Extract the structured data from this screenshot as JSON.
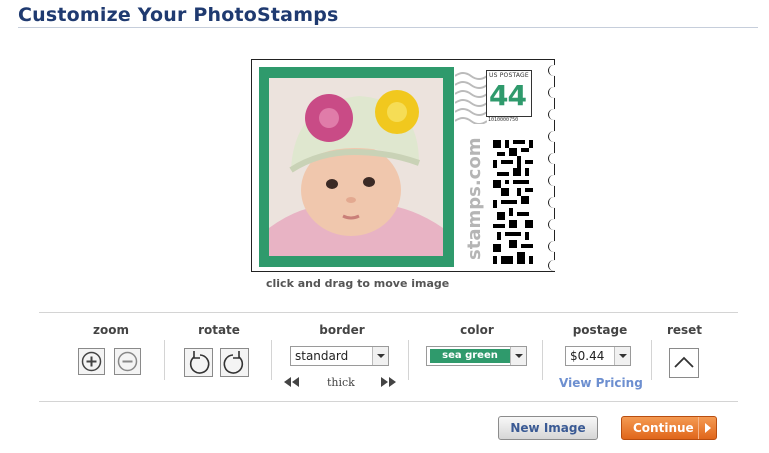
{
  "header": {
    "title": "Customize Your PhotoStamps"
  },
  "stamp": {
    "usps_label": "US POSTAGE",
    "denomination": "44",
    "code_number": "1010000750",
    "brand": "stamps.com",
    "border_color": "#2f9a6c"
  },
  "caption": "click and drag to move image",
  "controls": {
    "zoom": {
      "label": "zoom",
      "in_icon": "zoom-in-icon",
      "out_icon": "zoom-out-icon"
    },
    "rotate": {
      "label": "rotate",
      "left_icon": "rotate-left-icon",
      "right_icon": "rotate-right-icon"
    },
    "border": {
      "label": "border",
      "value": "standard",
      "hint": "thick"
    },
    "color": {
      "label": "color",
      "value": "sea green",
      "swatch": "#2f9a6c"
    },
    "postage": {
      "label": "postage",
      "value": "$0.44",
      "link": "View Pricing"
    },
    "reset": {
      "label": "reset",
      "icon": "reset-up-icon"
    }
  },
  "buttons": {
    "new_image": "New Image",
    "continue": "Continue"
  }
}
